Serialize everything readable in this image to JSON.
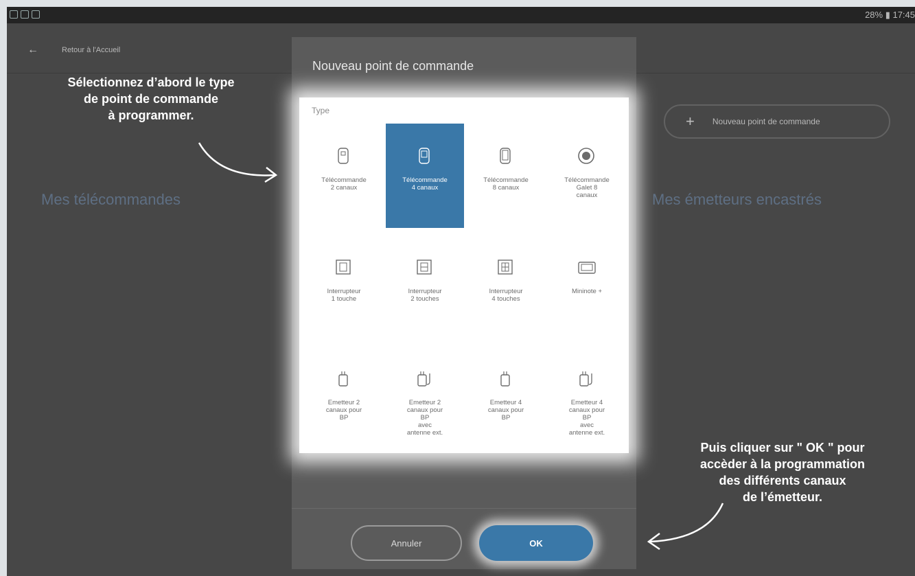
{
  "status_bar": {
    "right_text": "28% ▮ 17:45"
  },
  "app_bar": {
    "back_label": "Retour à l'Accueil"
  },
  "background": {
    "new_button_label": "Nouveau point de commande",
    "left_section": "Mes télécommandes",
    "right_section": "Mes émetteurs encastrés"
  },
  "annotations": {
    "top_left": "Sélectionnez d’abord le type\nde point de commande\nà programmer.",
    "bottom_right": "Puis cliquer sur \" OK \" pour\naccèder à la programmation\ndes différents canaux\nde l’émetteur."
  },
  "dialog": {
    "title": "Nouveau point de commande",
    "type_label": "Type",
    "types": [
      {
        "label": "Télécommande\n2 canaux",
        "icon": "remote-2-icon",
        "selected": false
      },
      {
        "label": "Télécommande\n4 canaux",
        "icon": "remote-4-icon",
        "selected": true
      },
      {
        "label": "Télécommande\n8 canaux",
        "icon": "remote-8-icon",
        "selected": false
      },
      {
        "label": "Télécommande\nGalet 8\ncanaux",
        "icon": "galet-icon",
        "selected": false
      },
      {
        "label": "Interrupteur\n1 touche",
        "icon": "switch-1-icon",
        "selected": false
      },
      {
        "label": "Interrupteur\n2 touches",
        "icon": "switch-2-icon",
        "selected": false
      },
      {
        "label": "Interrupteur\n4 touches",
        "icon": "switch-4-icon",
        "selected": false
      },
      {
        "label": "Mininote +",
        "icon": "mininote-icon",
        "selected": false
      },
      {
        "label": "Emetteur 2\ncanaux pour\nBP",
        "icon": "emitter-icon",
        "selected": false
      },
      {
        "label": "Emetteur 2\ncanaux pour\nBP\navec\nantenne ext.",
        "icon": "emitter-antenna-icon",
        "selected": false
      },
      {
        "label": "Emetteur 4\ncanaux pour\nBP",
        "icon": "emitter-icon",
        "selected": false
      },
      {
        "label": "Emetteur 4\ncanaux pour\nBP\navec\nantenne ext.",
        "icon": "emitter-antenna-icon",
        "selected": false
      }
    ],
    "cancel_label": "Annuler",
    "ok_label": "OK"
  },
  "colors": {
    "accent": "#3a78a8",
    "background": "#474747",
    "dialog": "#5b5b5b"
  }
}
